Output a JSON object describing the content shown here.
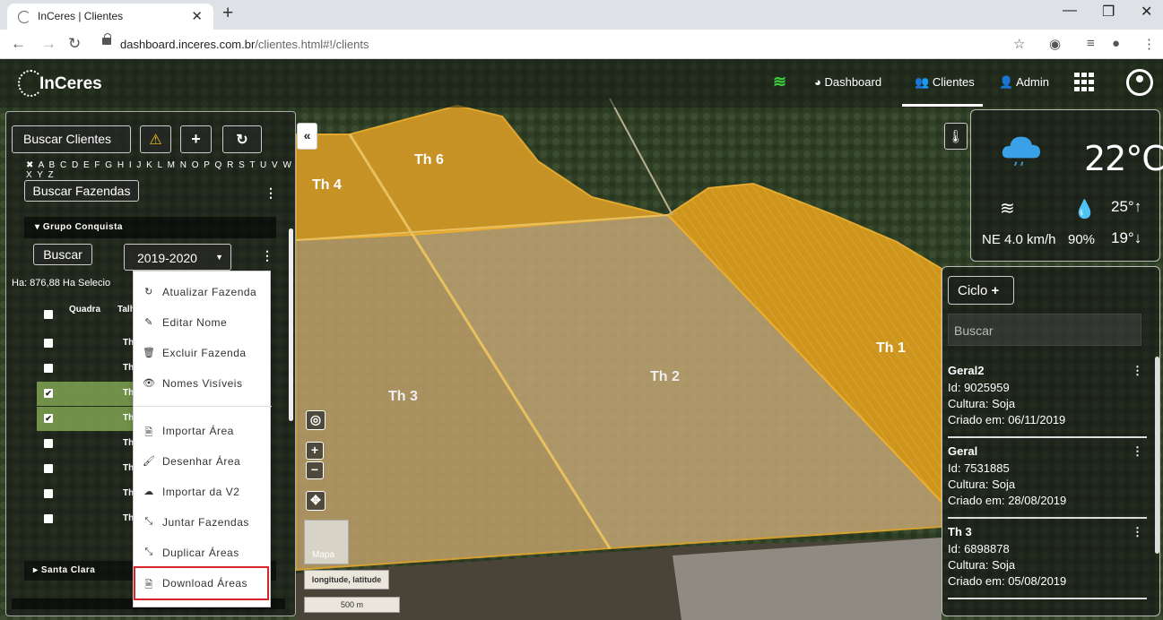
{
  "browser": {
    "tab_title": "InCeres | Clientes",
    "url_host": "dashboard.inceres.com.br",
    "url_path": "/clientes.html#!/clients"
  },
  "appbar": {
    "logo_text": "InCeres",
    "nav": [
      {
        "label": "Dashboard",
        "icon": "dashboard-icon"
      },
      {
        "label": "Clientes",
        "icon": "users-icon"
      },
      {
        "label": "Admin",
        "icon": "user-plus-icon"
      }
    ],
    "active_nav": "Clientes"
  },
  "left_panel": {
    "search_clients_label": "Buscar Clientes",
    "alphabet": "A B C D E F G H I J K L M N O P Q R S T U V W X Y Z",
    "search_farms_label": "Buscar Fazendas",
    "group_name": "Grupo Conquista",
    "search_button": "Buscar",
    "season_selected": "2019-2020",
    "ha_text": "Ha: 876,88   Ha Selecio",
    "col_quadra": "Quadra",
    "col_talhao": "Talh",
    "rows": [
      {
        "label": "Th",
        "checked": false
      },
      {
        "label": "Th",
        "checked": false
      },
      {
        "label": "Th",
        "checked": true
      },
      {
        "label": "Th",
        "checked": true
      },
      {
        "label": "Th",
        "checked": false
      },
      {
        "label": "Th",
        "checked": false
      },
      {
        "label": "Th",
        "checked": false
      },
      {
        "label": "Th",
        "checked": false
      }
    ],
    "group2_name": "Santa Clara"
  },
  "dropdown": {
    "items": [
      {
        "label": "Atualizar Fazenda",
        "icon": "refresh-icon",
        "glyph": "↻"
      },
      {
        "label": "Editar Nome",
        "icon": "pencil-icon",
        "glyph": "✎"
      },
      {
        "label": "Excluir Fazenda",
        "icon": "trash-icon",
        "glyph": "🗑"
      },
      {
        "label": "Nomes Visíveis",
        "icon": "eye-icon",
        "glyph": "👁"
      },
      {
        "label": "Importar Área",
        "icon": "file-import-icon",
        "glyph": "🗎"
      },
      {
        "label": "Desenhar Área",
        "icon": "brush-icon",
        "glyph": "🖌"
      },
      {
        "label": "Importar da V2",
        "icon": "cloud-upload-icon",
        "glyph": "☁"
      },
      {
        "label": "Juntar Fazendas",
        "icon": "compress-icon",
        "glyph": "⤡"
      },
      {
        "label": "Duplicar Áreas",
        "icon": "compress-icon",
        "glyph": "⤡"
      },
      {
        "label": "Download Áreas",
        "icon": "file-download-icon",
        "glyph": "🗎"
      }
    ],
    "highlighted": "Download Áreas"
  },
  "map": {
    "plots": [
      "Th 6",
      "Th 4",
      "Th 3",
      "Th 2",
      "Th 1"
    ],
    "thumb_label": "Mapa",
    "coord_label": "longitude, latitude",
    "scale_label": "500 m",
    "plot_color": "#e8a020"
  },
  "weather": {
    "temperature": "22°C",
    "wind": "NE 4.0 km/h",
    "humidity": "90%",
    "max_temp": "25°",
    "min_temp": "19°",
    "condition_icon": "cloud-rain-icon"
  },
  "right_panel": {
    "ciclo_label": "Ciclo",
    "search_placeholder": "Buscar",
    "cards": [
      {
        "name": "Geral2",
        "id": "Id: 9025959",
        "cultura": "Cultura: Soja",
        "criado": "Criado em: 06/11/2019"
      },
      {
        "name": "Geral",
        "id": "Id: 7531885",
        "cultura": "Cultura: Soja",
        "criado": "Criado em: 28/08/2019"
      },
      {
        "name": "Th 3",
        "id": "Id: 6898878",
        "cultura": "Cultura: Soja",
        "criado": "Criado em: 05/08/2019"
      }
    ]
  }
}
